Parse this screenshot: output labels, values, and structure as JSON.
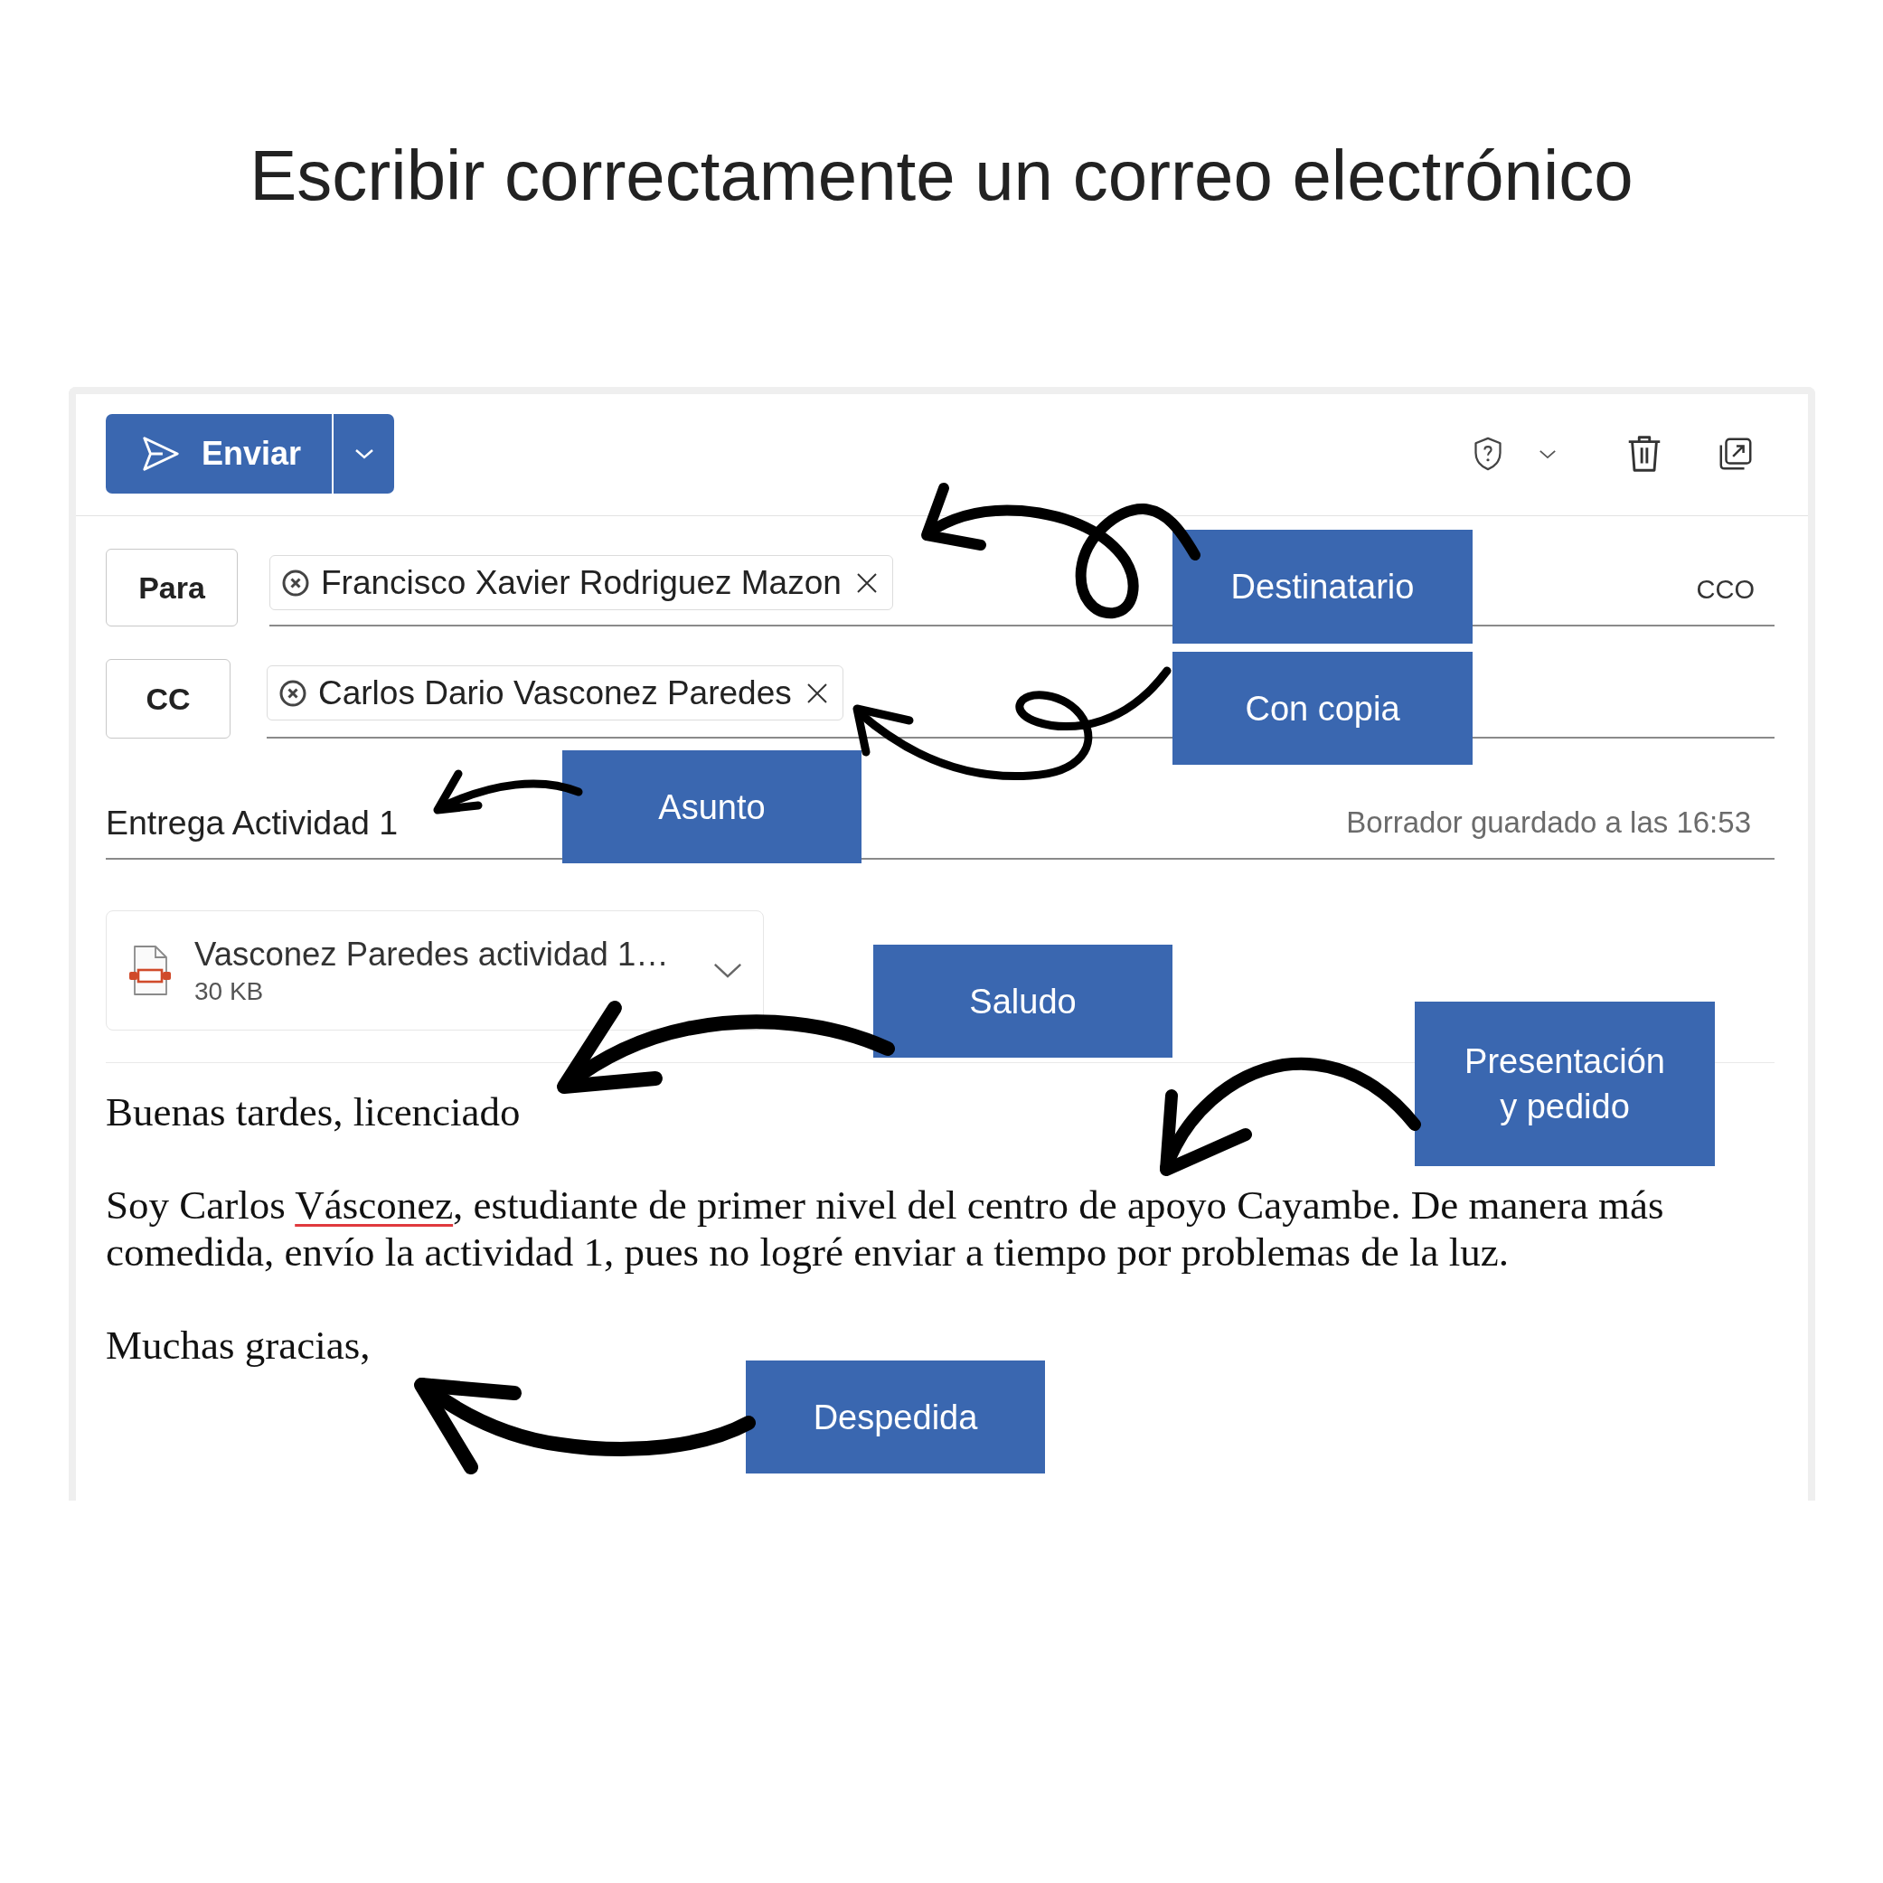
{
  "title": "Escribir correctamente un correo electrónico",
  "compose": {
    "send": {
      "label": "Enviar"
    },
    "to": {
      "label": "Para",
      "recipients": [
        {
          "name": "Francisco Xavier Rodriguez Mazon"
        }
      ],
      "bcc_link": "CCO"
    },
    "cc": {
      "label": "CC",
      "recipients": [
        {
          "name": "Carlos Dario Vasconez Paredes"
        }
      ]
    },
    "subject": {
      "value": "Entrega Actividad 1",
      "draft_status": "Borrador guardado a las 16:53"
    },
    "attachments": [
      {
        "name": "Vasconez Paredes actividad 1…",
        "size": "30 KB"
      }
    ],
    "body": {
      "paragraphs": [
        {
          "segments": [
            {
              "text": "Buenas tardes, licenciado",
              "misspelled": false
            }
          ]
        },
        {
          "segments": [
            {
              "text": "Soy Carlos ",
              "misspelled": false
            },
            {
              "text": "Vásconez",
              "misspelled": true
            },
            {
              "text": ", estudiante de primer nivel del centro de apoyo Cayambe. De manera más comedida, envío la actividad 1, pues no logré enviar a tiempo por problemas de la luz.",
              "misspelled": false
            }
          ]
        },
        {
          "segments": [
            {
              "text": "Muchas gracias,",
              "misspelled": false
            }
          ]
        }
      ]
    }
  },
  "annotations": [
    {
      "label": "Destinatario"
    },
    {
      "label": "Con copia"
    },
    {
      "label": "Asunto"
    },
    {
      "label": "Saludo"
    },
    {
      "label": "Presentación y pedido"
    },
    {
      "label": "Despedida"
    }
  ]
}
